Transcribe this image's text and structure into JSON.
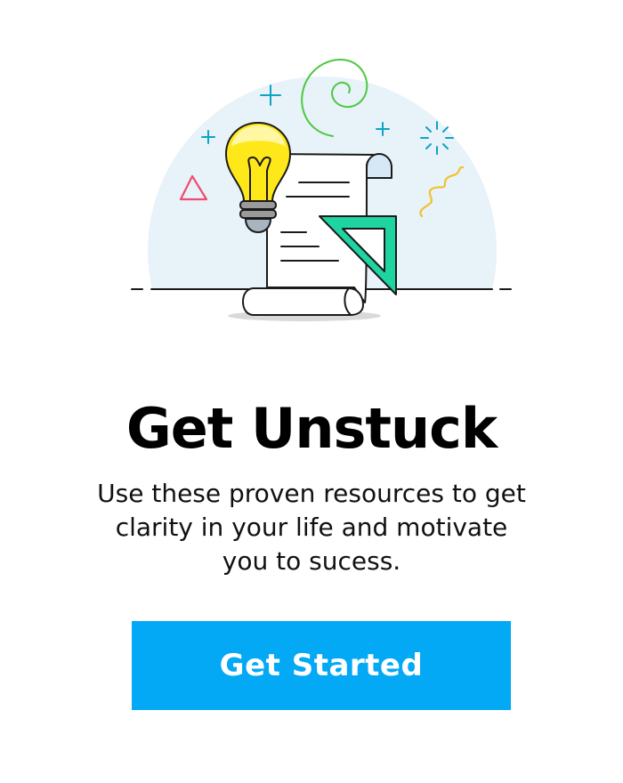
{
  "hero": {
    "illustration": "lightbulb-and-scroll-illustration",
    "colors": {
      "circle": "#e8f2f9",
      "bulb": "#ffe81a",
      "set_square": "#1ed4a0",
      "spiral": "#4cc93f",
      "sparkle": "#0fa3c6",
      "triangle": "#ef4d70",
      "squiggle": "#f2c12e"
    }
  },
  "content": {
    "title": "Get Unstuck",
    "subtitle": "Use these proven resources to get clarity in your life and motivate you to sucess."
  },
  "cta": {
    "label": "Get Started",
    "color": "#03a9f4"
  }
}
